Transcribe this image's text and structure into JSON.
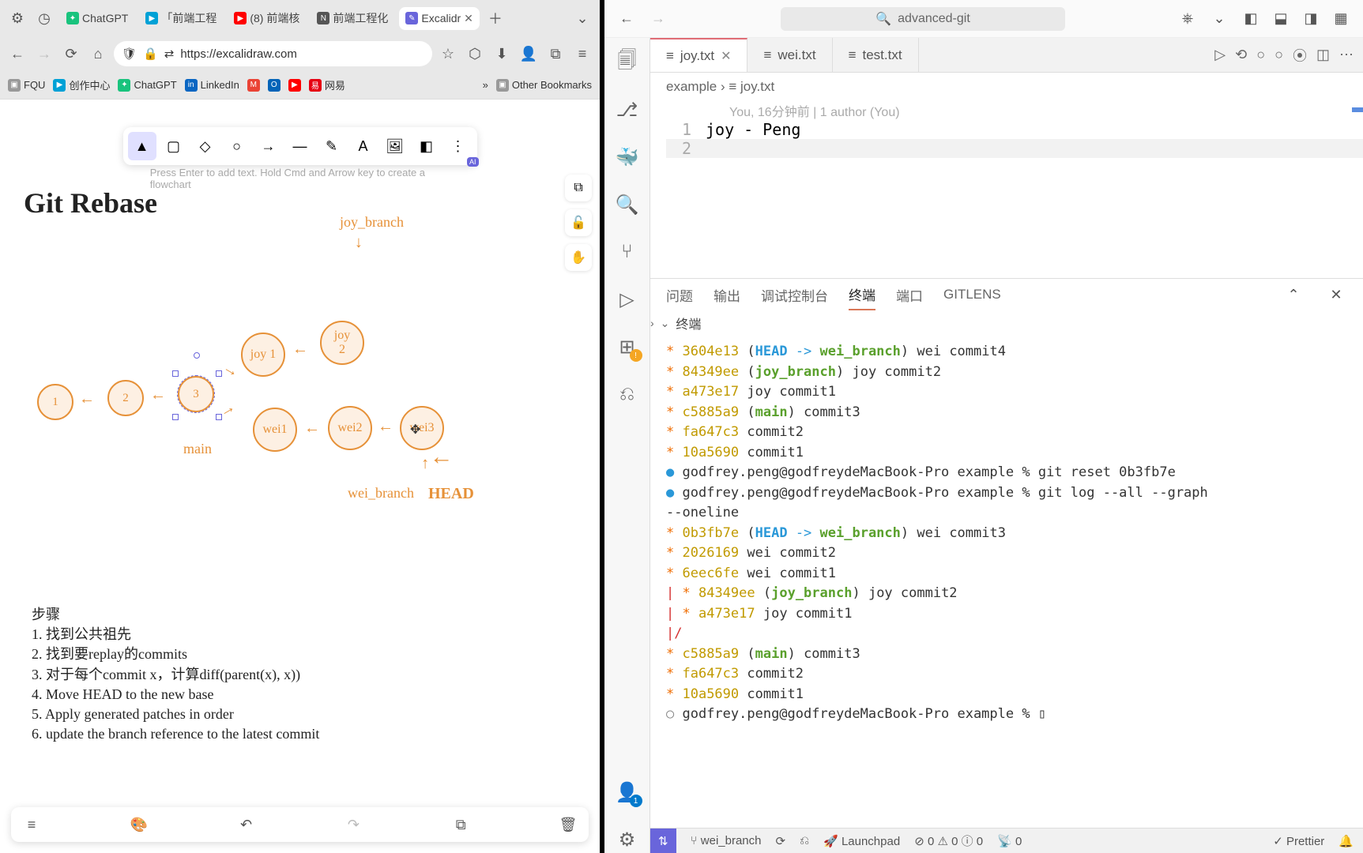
{
  "browser": {
    "tabs": [
      {
        "icon": "chatgpt",
        "label": "ChatGPT"
      },
      {
        "icon": "bilibili",
        "label": "「前端工程"
      },
      {
        "icon": "youtube",
        "label": "(8) 前端核"
      },
      {
        "icon": "notion",
        "label": "前端工程化"
      },
      {
        "icon": "excalidraw",
        "label": "Excalidr"
      }
    ],
    "active_tab": 4,
    "url": "https://excalidraw.com",
    "bookmarks": [
      {
        "icon": "folder",
        "label": "FQU"
      },
      {
        "icon": "bilibili",
        "label": "创作中心"
      },
      {
        "icon": "chatgpt",
        "label": "ChatGPT"
      },
      {
        "icon": "linkedin",
        "label": "LinkedIn"
      },
      {
        "icon": "gmail",
        "label": ""
      },
      {
        "icon": "outlook",
        "label": ""
      },
      {
        "icon": "youtube",
        "label": ""
      },
      {
        "icon": "netease",
        "label": "网易"
      }
    ],
    "other_bookmarks": "Other Bookmarks"
  },
  "excalidraw": {
    "hint": "Press Enter to add text. Hold Cmd and Arrow key to create a flowchart",
    "ai_badge": "AI",
    "title": "Git Rebase",
    "labels": {
      "joy_branch": "joy_branch",
      "main": "main",
      "wei_branch": "wei_branch",
      "head": "HEAD"
    },
    "nodes": {
      "n1": "1",
      "n2": "2",
      "n3": "3",
      "joy1": "joy 1",
      "joy2": "joy\n2",
      "wei1": "wei1",
      "wei2": "wei2",
      "wei3": "wei3"
    },
    "steps_title": "步骤",
    "steps": [
      "1. 找到公共祖先",
      "2. 找到要replay的commits",
      "3. 对于每个commit x，计算diff(parent(x), x))",
      "4. Move HEAD to the new base",
      "5. Apply generated patches in order",
      "6. update the branch reference to the latest commit"
    ]
  },
  "vscode": {
    "search": "advanced-git",
    "tabs": [
      {
        "name": "joy.txt",
        "active": true
      },
      {
        "name": "wei.txt",
        "active": false
      },
      {
        "name": "test.txt",
        "active": false
      }
    ],
    "breadcrumb": [
      "example",
      "joy.txt"
    ],
    "blame": "You, 16分钟前 | 1 author (You)",
    "code_line": "joy - Peng",
    "panel_tabs": [
      "问题",
      "输出",
      "调试控制台",
      "终端",
      "端口",
      "GITLENS"
    ],
    "panel_active": "终端",
    "terminal_section": "终端",
    "terminal_lines": [
      {
        "t": "log",
        "graph": "* ",
        "hash": "3604e13",
        "refs": "(HEAD -> wei_branch)",
        "ref_head": true,
        "msg": " wei commit4"
      },
      {
        "t": "log",
        "graph": "* ",
        "hash": "84349ee",
        "refs": "(joy_branch)",
        "msg": " joy commit2"
      },
      {
        "t": "log",
        "graph": "* ",
        "hash": "a473e17",
        "msg": " joy commit1"
      },
      {
        "t": "log",
        "graph": "* ",
        "hash": "c5885a9",
        "refs": "(main)",
        "msg": " commit3"
      },
      {
        "t": "log",
        "graph": "* ",
        "hash": "fa647c3",
        "msg": " commit2"
      },
      {
        "t": "log",
        "graph": "* ",
        "hash": "10a5690",
        "msg": " commit1"
      },
      {
        "t": "cmd",
        "dot": "blue",
        "prompt": "godfrey.peng@godfreydeMacBook-Pro example % ",
        "cmd": "git reset 0b3fb7e"
      },
      {
        "t": "cmd",
        "dot": "blue",
        "prompt": "godfrey.peng@godfreydeMacBook-Pro example % ",
        "cmd": "git log --all --graph"
      },
      {
        "t": "cont",
        "text": "--oneline"
      },
      {
        "t": "log",
        "graph": "* ",
        "hash": "0b3fb7e",
        "refs": "(HEAD -> wei_branch)",
        "ref_head": true,
        "msg": " wei commit3"
      },
      {
        "t": "log",
        "graph": "* ",
        "hash": "2026169",
        "msg": " wei commit2"
      },
      {
        "t": "log",
        "graph": "* ",
        "hash": "6eec6fe",
        "msg": " wei commit1"
      },
      {
        "t": "log2",
        "graph": "| * ",
        "hash": "84349ee",
        "refs": "(joy_branch)",
        "msg": " joy commit2"
      },
      {
        "t": "log2",
        "graph": "| * ",
        "hash": "a473e17",
        "msg": " joy commit1"
      },
      {
        "t": "graph",
        "text": "|/"
      },
      {
        "t": "log",
        "graph": "* ",
        "hash": "c5885a9",
        "refs": "(main)",
        "msg": " commit3"
      },
      {
        "t": "log",
        "graph": "* ",
        "hash": "fa647c3",
        "msg": " commit2"
      },
      {
        "t": "log",
        "graph": "* ",
        "hash": "10a5690",
        "msg": " commit1"
      },
      {
        "t": "cmd",
        "dot": "open",
        "prompt": "godfrey.peng@godfreydeMacBook-Pro example % ",
        "cmd": "▯"
      }
    ],
    "status": {
      "branch": "wei_branch",
      "launchpad": "Launchpad",
      "err": "0",
      "warn": "0",
      "port": "0",
      "prettier": "Prettier"
    }
  }
}
